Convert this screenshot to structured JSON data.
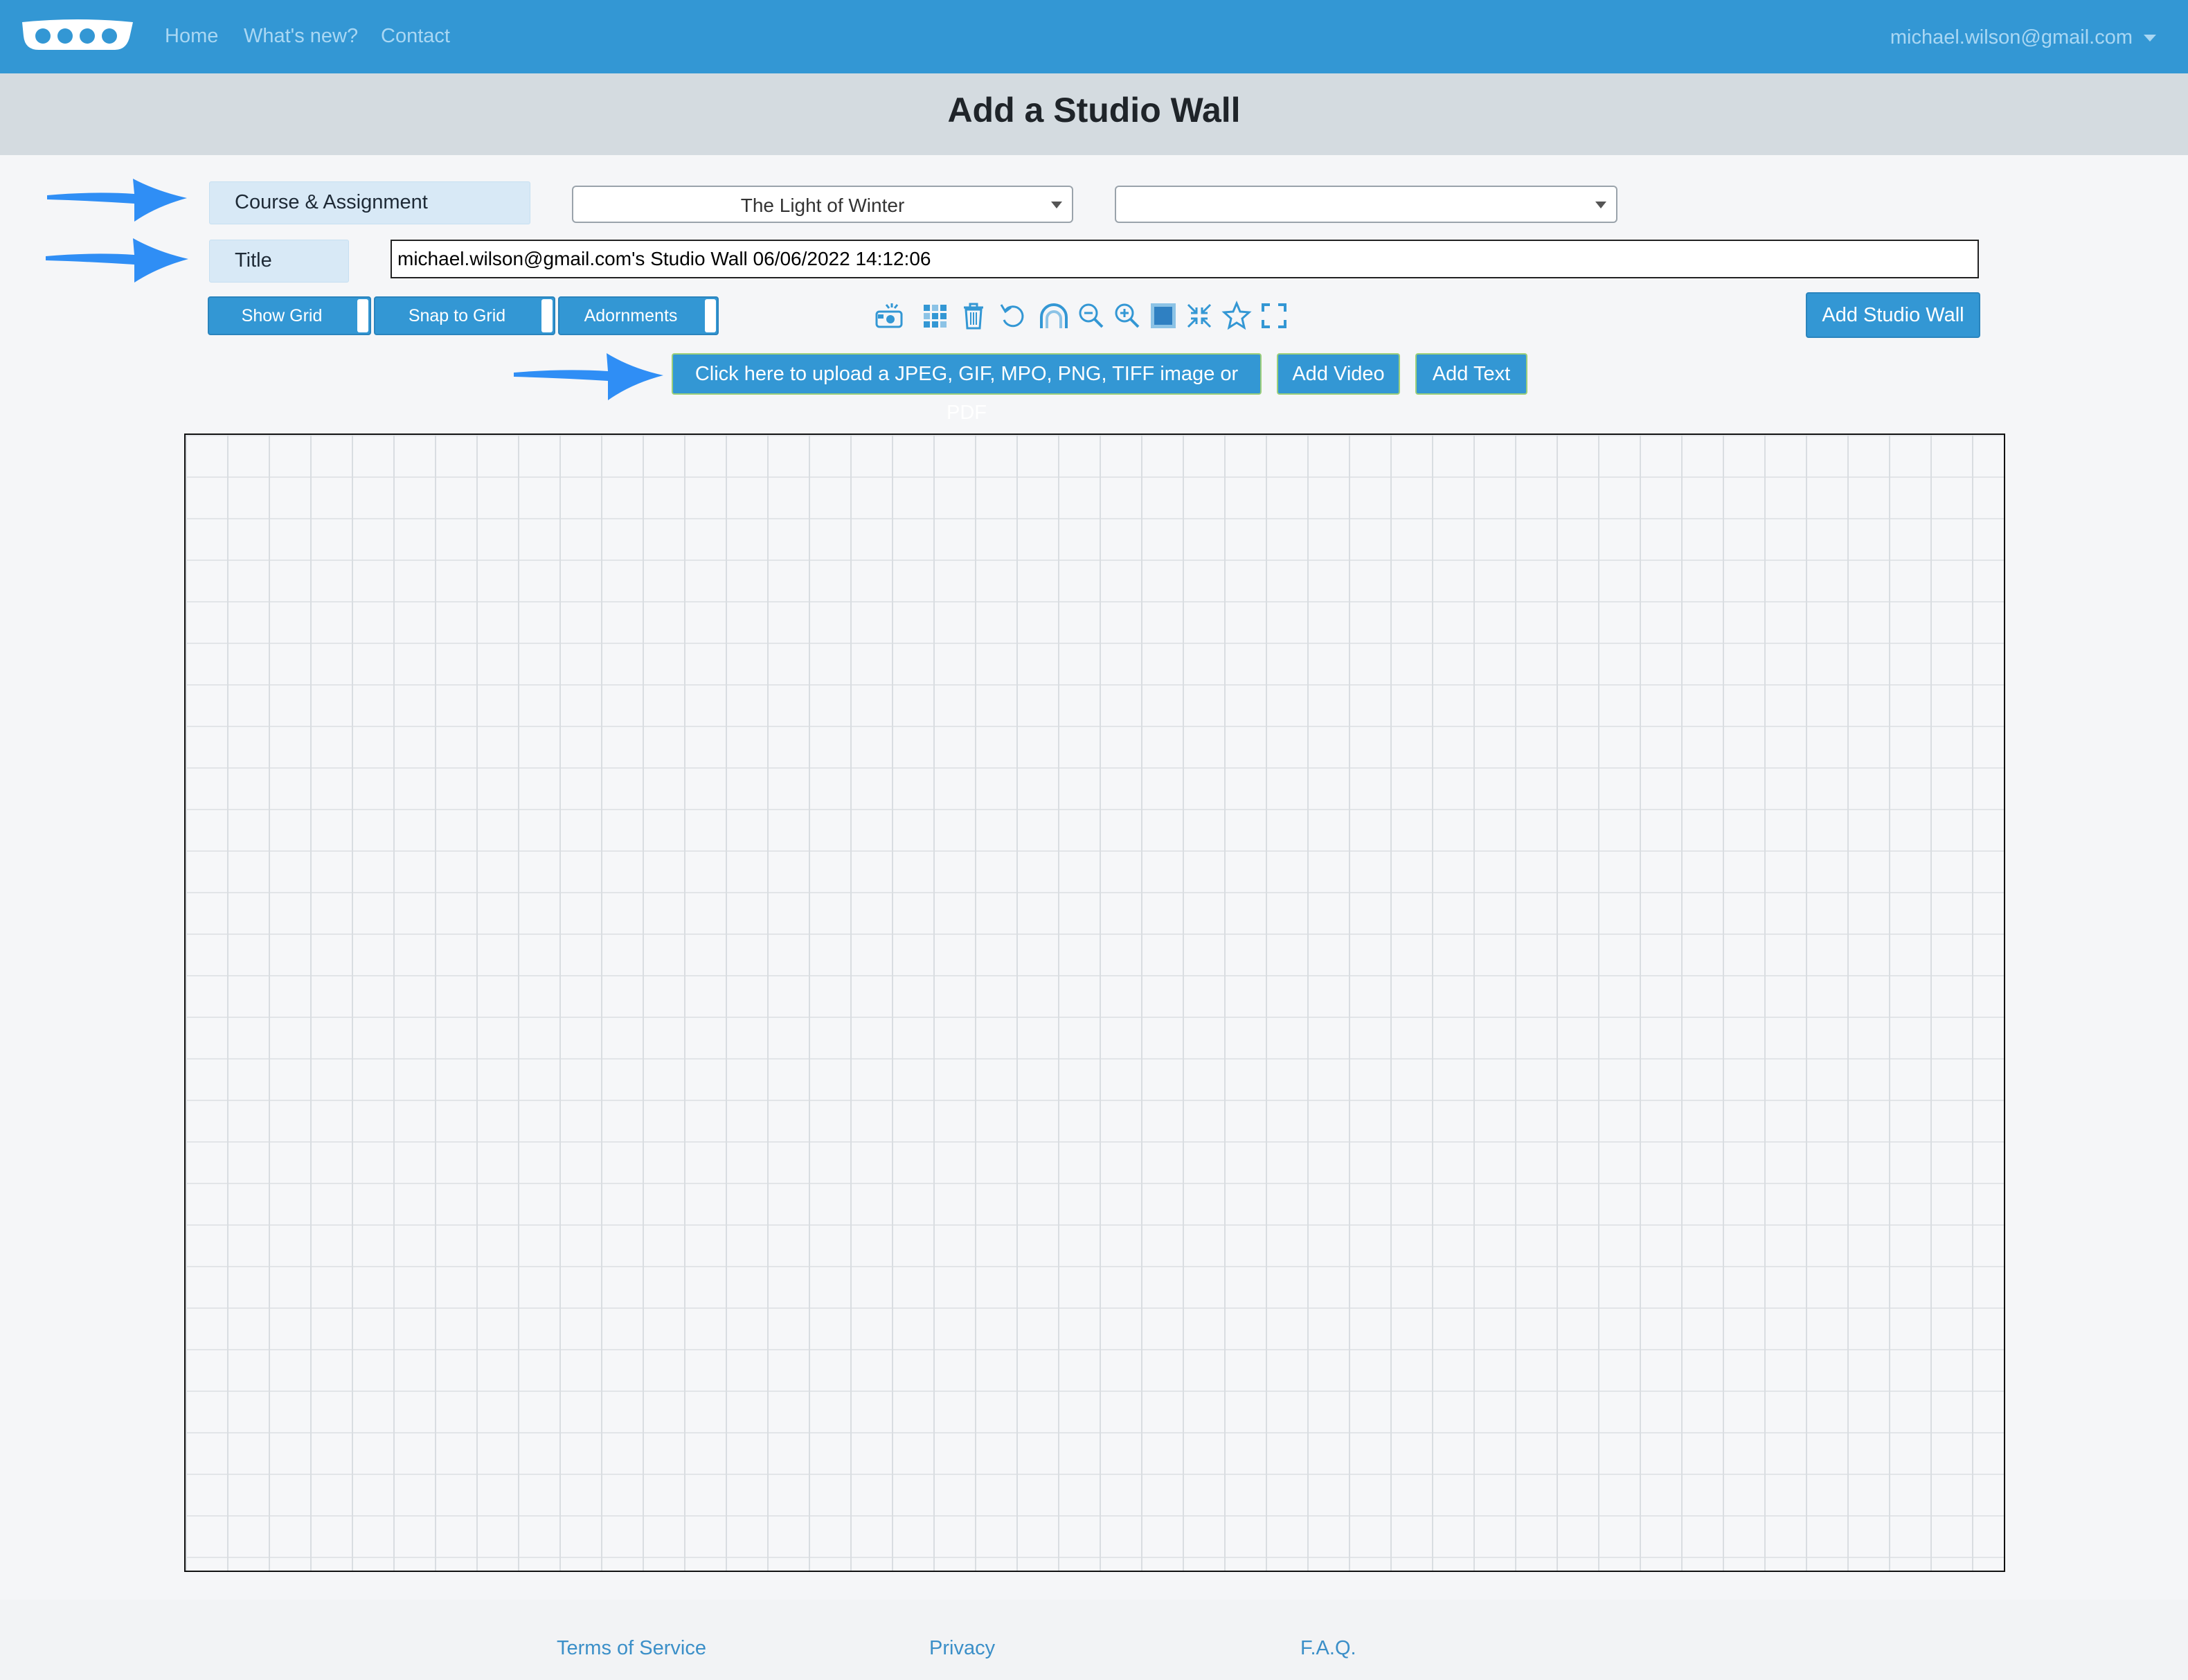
{
  "nav": {
    "logo": "site-logo",
    "links": [
      "Home",
      "What's new?",
      "Contact"
    ],
    "user_email": "michael.wilson@gmail.com"
  },
  "header": {
    "title": "Add a Studio Wall"
  },
  "form": {
    "course_label": "Course & Assignment",
    "course_value": "The Light of Winter",
    "assignment_value": "",
    "title_label": "Title",
    "title_value": "michael.wilson@gmail.com's Studio Wall 06/06/2022 14:12:06"
  },
  "toggles": {
    "show_grid": "Show Grid",
    "snap_to_grid": "Snap to Grid",
    "adornments": "Adornments"
  },
  "toolbar_icons": [
    "camera-icon",
    "grid-pattern-icon",
    "trash-icon",
    "undo-icon",
    "arch-icon",
    "zoom-out-icon",
    "zoom-in-icon",
    "fill-square-icon",
    "shrink-icon",
    "star-icon",
    "expand-icon"
  ],
  "actions": {
    "add_studio_wall": "Add Studio Wall",
    "upload": "Click here to upload a JPEG, GIF, MPO, PNG, TIFF image or PDF",
    "add_video": "Add Video",
    "add_text": "Add Text"
  },
  "footer": {
    "terms": "Terms of Service",
    "privacy": "Privacy",
    "faq": "F.A.Q."
  },
  "colors": {
    "navbar": "#3397d4",
    "button": "#3397d4",
    "header_band": "#d4dbe0",
    "label_bg": "#d8e9f6",
    "arrow": "#2f8ef5"
  }
}
